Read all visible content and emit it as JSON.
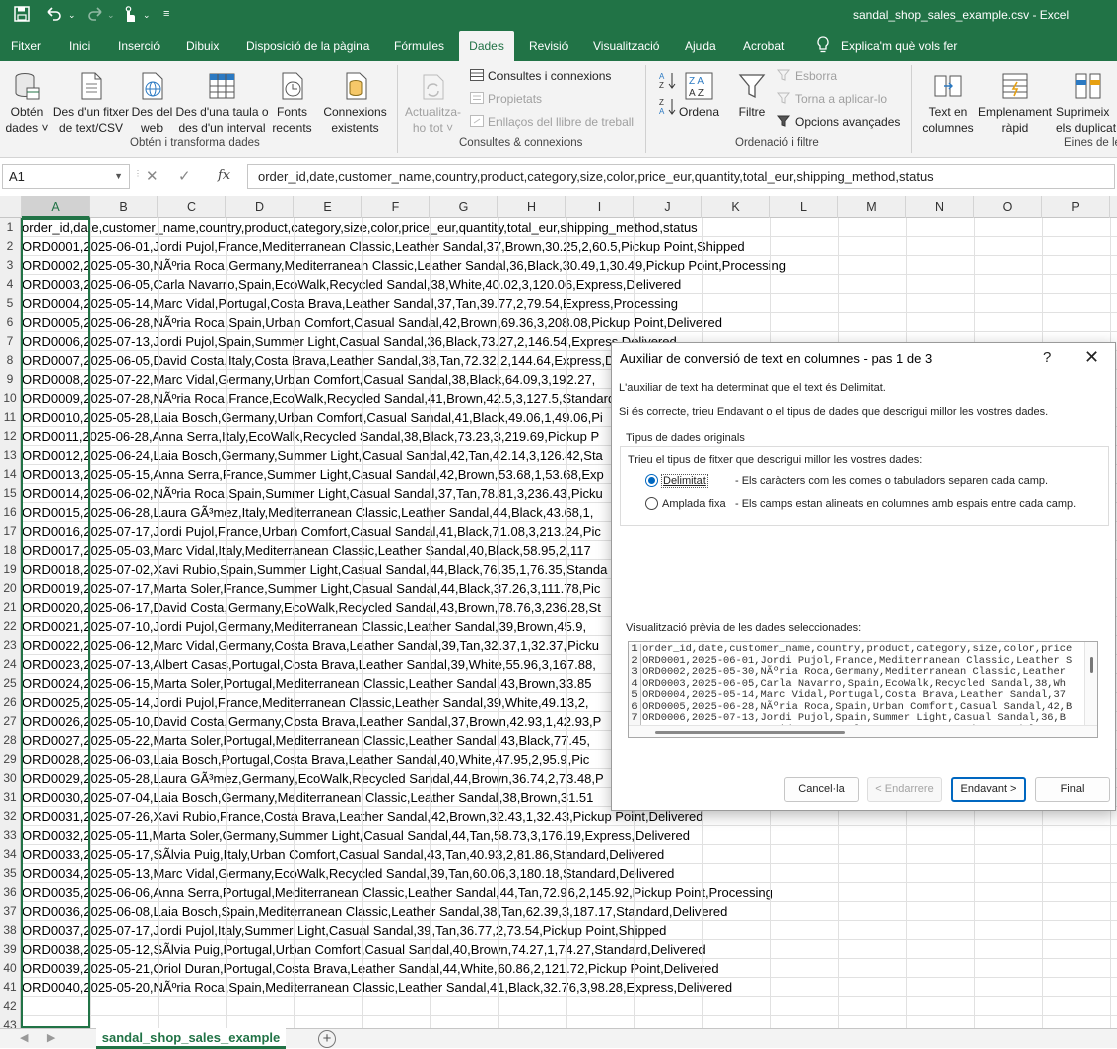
{
  "window": {
    "title": "sandal_shop_sales_example.csv  -  Excel",
    "quick_access": {
      "save_icon": "save-icon",
      "undo_icon": "undo-icon",
      "redo_icon": "redo-icon",
      "touch_icon": "touch-mode-icon",
      "customize_icon": "customize-qat-icon"
    }
  },
  "menu_tabs": [
    "Fitxer",
    "Inici",
    "Inserció",
    "Dibuix",
    "Disposició de la pàgina",
    "Fórmules",
    "Dades",
    "Revisió",
    "Visualització",
    "Ajuda",
    "Acrobat",
    "Explica'm què vols fer"
  ],
  "active_tab": "Dades",
  "ribbon": {
    "get_transform": {
      "label": "Obtén i transforma dades",
      "buttons": [
        {
          "l1": "Obtén",
          "l2": "dades ˅"
        },
        {
          "l1": "Des d'un fitxer",
          "l2": "de text/CSV"
        },
        {
          "l1": "Des del",
          "l2": "web"
        },
        {
          "l1": "Des d'una taula o",
          "l2": "des d'un interval"
        },
        {
          "l1": "Fonts",
          "l2": "recents"
        },
        {
          "l1": "Connexions",
          "l2": "existents"
        }
      ]
    },
    "queries": {
      "label": "Consultes & connexions",
      "refresh": {
        "l1": "Actualitza-",
        "l2": "ho tot ˅"
      },
      "items": [
        "Consultes i connexions",
        "Propietats",
        "Enllaços del llibre de treball"
      ]
    },
    "sort_filter": {
      "label": "Ordenació i filtre",
      "sort": "Ordena",
      "filter": "Filtre",
      "items": [
        "Esborra",
        "Torna a aplicar-lo",
        "Opcions avançades"
      ]
    },
    "data_tools": {
      "label": "Eines de le",
      "buttons": [
        {
          "l1": "Text en",
          "l2": "columnes"
        },
        {
          "l1": "Emplenament",
          "l2": "ràpid"
        },
        {
          "l1": "Suprimeix",
          "l2": "els duplicat"
        }
      ]
    }
  },
  "formula_bar": {
    "name_box": "A1",
    "content": "order_id,date,customer_name,country,product,category,size,color,price_eur,quantity,total_eur,shipping_method,status"
  },
  "columns": [
    "A",
    "B",
    "C",
    "D",
    "E",
    "F",
    "G",
    "H",
    "I",
    "J",
    "K",
    "L",
    "M",
    "N",
    "O",
    "P"
  ],
  "rows": [
    "order_id,date,customer_name,country,product,category,size,color,price_eur,quantity,total_eur,shipping_method,status",
    "ORD0001,2025-06-01,Jordi Pujol,France,Mediterranean Classic,Leather Sandal,37,Brown,30.25,2,60.5,Pickup Point,Shipped",
    "ORD0002,2025-05-30,NÃºria Roca,Germany,Mediterranean Classic,Leather Sandal,36,Black,30.49,1,30.49,Pickup Point,Processing",
    "ORD0003,2025-06-05,Carla Navarro,Spain,EcoWalk,Recycled Sandal,38,White,40.02,3,120.06,Express,Delivered",
    "ORD0004,2025-05-14,Marc Vidal,Portugal,Costa Brava,Leather Sandal,37,Tan,39.77,2,79.54,Express,Processing",
    "ORD0005,2025-06-28,NÃºria Roca,Spain,Urban Comfort,Casual Sandal,42,Brown,69.36,3,208.08,Pickup Point,Delivered",
    "ORD0006,2025-07-13,Jordi Pujol,Spain,Summer Light,Casual Sandal,36,Black,73.27,2,146.54,Express,Delivered",
    "ORD0007,2025-06-05,David Costa,Italy,Costa Brava,Leather Sandal,38,Tan,72.32,2,144.64,Express,Delivered",
    "ORD0008,2025-07-22,Marc Vidal,Germany,Urban Comfort,Casual Sandal,38,Black,64.09,3,192.27,",
    "ORD0009,2025-07-28,NÃºria Roca,France,EcoWalk,Recycled Sandal,41,Brown,42.5,3,127.5,Standard",
    "ORD0010,2025-05-28,Laia Bosch,Germany,Urban Comfort,Casual Sandal,41,Black,49.06,1,49.06,Pi",
    "ORD0011,2025-06-28,Anna Serra,Italy,EcoWalk,Recycled Sandal,38,Black,73.23,3,219.69,Pickup P",
    "ORD0012,2025-06-24,Laia Bosch,Germany,Summer Light,Casual Sandal,42,Tan,42.14,3,126.42,Sta",
    "ORD0013,2025-05-15,Anna Serra,France,Summer Light,Casual Sandal,42,Brown,53.68,1,53.68,Exp",
    "ORD0014,2025-06-02,NÃºria Roca,Spain,Summer Light,Casual Sandal,37,Tan,78.81,3,236.43,Picku",
    "ORD0015,2025-06-28,Laura GÃ³mez,Italy,Mediterranean Classic,Leather Sandal,44,Black,43.68,1,",
    "ORD0016,2025-07-17,Jordi Pujol,France,Urban Comfort,Casual Sandal,41,Black,71.08,3,213.24,Pic",
    "ORD0017,2025-05-03,Marc Vidal,Italy,Mediterranean Classic,Leather Sandal,40,Black,58.95,2,117",
    "ORD0018,2025-07-02,Xavi Rubio,Spain,Summer Light,Casual Sandal,44,Black,76.35,1,76.35,Standa",
    "ORD0019,2025-07-17,Marta Soler,France,Summer Light,Casual Sandal,44,Black,37.26,3,111.78,Pic",
    "ORD0020,2025-06-17,David Costa,Germany,EcoWalk,Recycled Sandal,43,Brown,78.76,3,236.28,St",
    "ORD0021,2025-07-10,Jordi Pujol,Germany,Mediterranean Classic,Leather Sandal,39,Brown,45.9,",
    "ORD0022,2025-06-12,Marc Vidal,Germany,Costa Brava,Leather Sandal,39,Tan,32.37,1,32.37,Picku",
    "ORD0023,2025-07-13,Albert Casas,Portugal,Costa Brava,Leather Sandal,39,White,55.96,3,167.88,",
    "ORD0024,2025-06-15,Marta Soler,Portugal,Mediterranean Classic,Leather Sandal,43,Brown,33.85",
    "ORD0025,2025-05-14,Jordi Pujol,France,Mediterranean Classic,Leather Sandal,39,White,49.13,2,",
    "ORD0026,2025-05-10,David Costa,Germany,Costa Brava,Leather Sandal,37,Brown,42.93,1,42.93,P",
    "ORD0027,2025-05-22,Marta Soler,Portugal,Mediterranean Classic,Leather Sandal,43,Black,77.45,",
    "ORD0028,2025-06-03,Laia Bosch,Portugal,Costa Brava,Leather Sandal,40,White,47.95,2,95.9,Pic",
    "ORD0029,2025-05-28,Laura GÃ³mez,Germany,EcoWalk,Recycled Sandal,44,Brown,36.74,2,73.48,P",
    "ORD0030,2025-07-04,Laia Bosch,Germany,Mediterranean Classic,Leather Sandal,38,Brown,31.51",
    "ORD0031,2025-07-26,Xavi Rubio,France,Costa Brava,Leather Sandal,42,Brown,32.43,1,32.43,Pickup Point,Delivered",
    "ORD0032,2025-05-11,Marta Soler,Germany,Summer Light,Casual Sandal,44,Tan,58.73,3,176.19,Express,Delivered",
    "ORD0033,2025-05-17,SÃ­lvia Puig,Italy,Urban Comfort,Casual Sandal,43,Tan,40.93,2,81.86,Standard,Delivered",
    "ORD0034,2025-05-13,Marc Vidal,Germany,EcoWalk,Recycled Sandal,39,Tan,60.06,3,180.18,Standard,Delivered",
    "ORD0035,2025-06-06,Anna Serra,Portugal,Mediterranean Classic,Leather Sandal,44,Tan,72.96,2,145.92,Pickup Point,Processing",
    "ORD0036,2025-06-08,Laia Bosch,Spain,Mediterranean Classic,Leather Sandal,38,Tan,62.39,3,187.17,Standard,Delivered",
    "ORD0037,2025-07-17,Jordi Pujol,Italy,Summer Light,Casual Sandal,39,Tan,36.77,2,73.54,Pickup Point,Shipped",
    "ORD0038,2025-05-12,SÃ­lvia Puig,Portugal,Urban Comfort,Casual Sandal,40,Brown,74.27,1,74.27,Standard,Delivered",
    "ORD0039,2025-05-21,Oriol Duran,Portugal,Costa Brava,Leather Sandal,44,White,60.86,2,121.72,Pickup Point,Delivered",
    "ORD0040,2025-05-20,NÃºria Roca,Spain,Mediterranean Classic,Leather Sandal,41,Black,32.76,3,98.28,Express,Delivered",
    "",
    ""
  ],
  "dialog": {
    "title": "Auxiliar de conversió de text en columnes - pas 1 de 3",
    "help": "?",
    "close": "✕",
    "intro1": "L'auxiliar de text ha determinat que el text és Delimitat.",
    "intro2": "Si és correcte, trieu Endavant o el tipus de dades que descrigui millor les vostres dades.",
    "group_label": "Tipus de dades originals",
    "group_prompt": "Trieu el tipus de fitxer que descrigui millor les vostres dades:",
    "options": [
      {
        "label": "Delimitat",
        "desc": "- Els caràcters com les comes o tabuladors separen cada camp.",
        "selected": true
      },
      {
        "label": "Amplada fixa",
        "desc": "- Els camps estan alineats en columnes amb espais entre cada camp.",
        "selected": false
      }
    ],
    "preview_label": "Visualització prèvia de les dades seleccionades:",
    "preview_lines": [
      "order_id,date,customer_name,country,product,category,size,color,price",
      "ORD0001,2025-06-01,Jordi Pujol,France,Mediterranean Classic,Leather S",
      "ORD0002,2025-05-30,NÃºria Roca,Germany,Mediterranean Classic,Leather",
      "ORD0003,2025-06-05,Carla Navarro,Spain,EcoWalk,Recycled Sandal,38,Wh",
      "ORD0004,2025-05-14,Marc Vidal,Portugal,Costa Brava,Leather Sandal,37",
      "ORD0005,2025-06-28,NÃºria Roca,Spain,Urban Comfort,Casual Sandal,42,B",
      "ORD0006,2025-07-13,Jordi Pujol,Spain,Summer Light,Casual Sandal,36,B",
      "ORD0007,2025-06-05,David Costa,Italy,Costa Brava,Leather Sandal,38,T"
    ],
    "buttons": {
      "cancel": "Cancel·la",
      "back": "< Endarrere",
      "next": "Endavant >",
      "finish": "Final"
    }
  },
  "sheet_tab": "sandal_shop_sales_example",
  "colors": {
    "accent": "#217346",
    "dialog_accent": "#0067c0"
  }
}
